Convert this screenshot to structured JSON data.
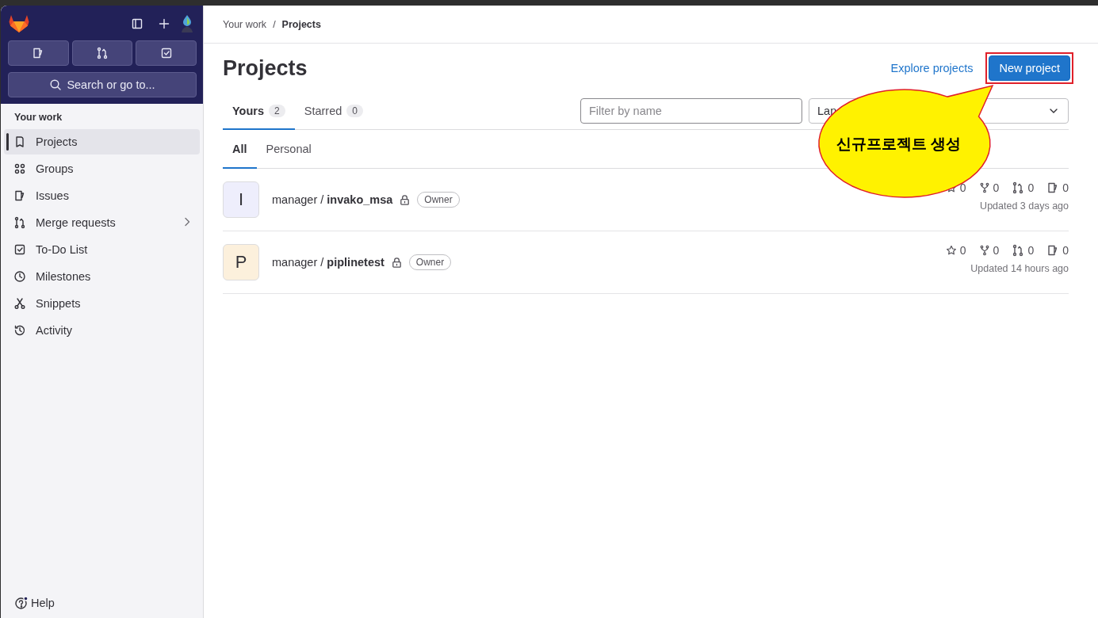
{
  "sidebar": {
    "search_button": "Search or go to...",
    "section_title": "Your work",
    "items": [
      {
        "label": "Projects",
        "selected": true,
        "has_submenu": false
      },
      {
        "label": "Groups",
        "selected": false,
        "has_submenu": false
      },
      {
        "label": "Issues",
        "selected": false,
        "has_submenu": false
      },
      {
        "label": "Merge requests",
        "selected": false,
        "has_submenu": true
      },
      {
        "label": "To-Do List",
        "selected": false,
        "has_submenu": false
      },
      {
        "label": "Milestones",
        "selected": false,
        "has_submenu": false
      },
      {
        "label": "Snippets",
        "selected": false,
        "has_submenu": false
      },
      {
        "label": "Activity",
        "selected": false,
        "has_submenu": false
      }
    ],
    "help": "Help"
  },
  "breadcrumb": [
    "Your work",
    "Projects"
  ],
  "breadcrumb_separator": "/",
  "page_title": "Projects",
  "actions": {
    "explore": "Explore projects",
    "new_project": "New project"
  },
  "tabs": [
    {
      "label": "Yours",
      "count": "2",
      "selected": true
    },
    {
      "label": "Starred",
      "count": "0",
      "selected": false
    }
  ],
  "filter": {
    "placeholder": "Filter by name"
  },
  "language_dropdown": {
    "value": "Lan"
  },
  "subtabs": [
    {
      "label": "All",
      "selected": true
    },
    {
      "label": "Personal",
      "selected": false
    }
  ],
  "projects": [
    {
      "letter": "I",
      "color": "#eeeefc",
      "namespace": "manager /",
      "name": "invako_msa",
      "private": true,
      "role": "Owner",
      "star_count": "0",
      "forks": "0",
      "merge_requests": "0",
      "issues": "0",
      "updated": "Updated 3 days ago"
    },
    {
      "letter": "P",
      "color": "#fcf0dc",
      "namespace": "manager /",
      "name": "piplinetest",
      "private": true,
      "role": "Owner",
      "star_count": "0",
      "forks": "0",
      "merge_requests": "0",
      "issues": "0",
      "updated": "Updated 14 hours ago"
    }
  ],
  "annotation": {
    "text": "신규프로젝트 생성"
  }
}
